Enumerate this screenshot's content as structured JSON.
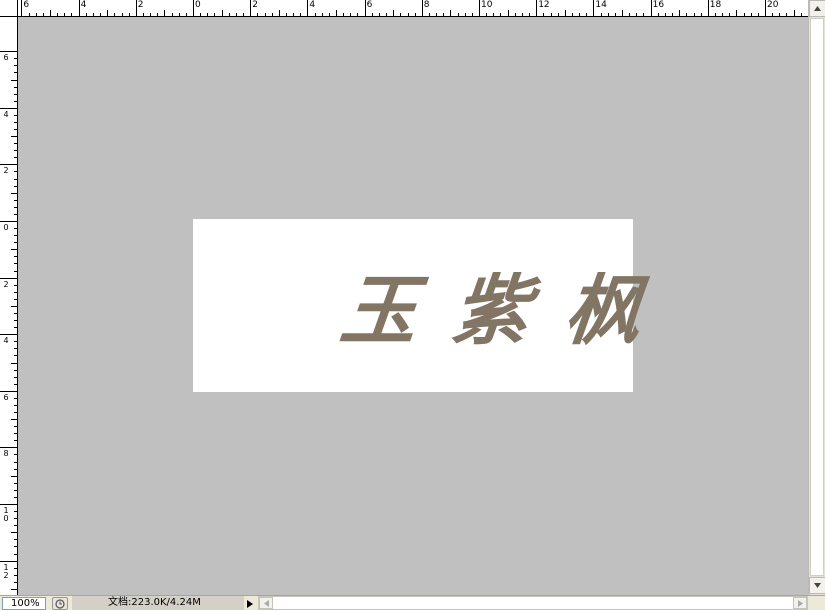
{
  "status_bar": {
    "zoom": "100%",
    "doc_info": "文档:223.0K/4.24M"
  },
  "ruler_top": {
    "labels": [
      "6",
      "4",
      "2",
      "0",
      "2",
      "4",
      "6",
      "8",
      "10",
      "12",
      "14",
      "16",
      "18",
      "20"
    ]
  },
  "ruler_left": {
    "labels": [
      "6",
      "4",
      "2",
      "0",
      "2",
      "4",
      "6",
      "8",
      "10",
      "12"
    ]
  },
  "canvas": {
    "calligraphy": [
      "玉",
      "紫",
      "枫"
    ],
    "ink_color": "#827564",
    "pasteboard_color": "#c0c0c0",
    "document_color": "#ffffff"
  },
  "icons": {
    "history": "history-icon",
    "info_arrow": "triangle-right-icon",
    "scroll_up": "arrow-up-icon",
    "scroll_down": "arrow-down-icon",
    "scroll_left": "arrow-left-icon",
    "scroll_right": "arrow-right-icon"
  }
}
